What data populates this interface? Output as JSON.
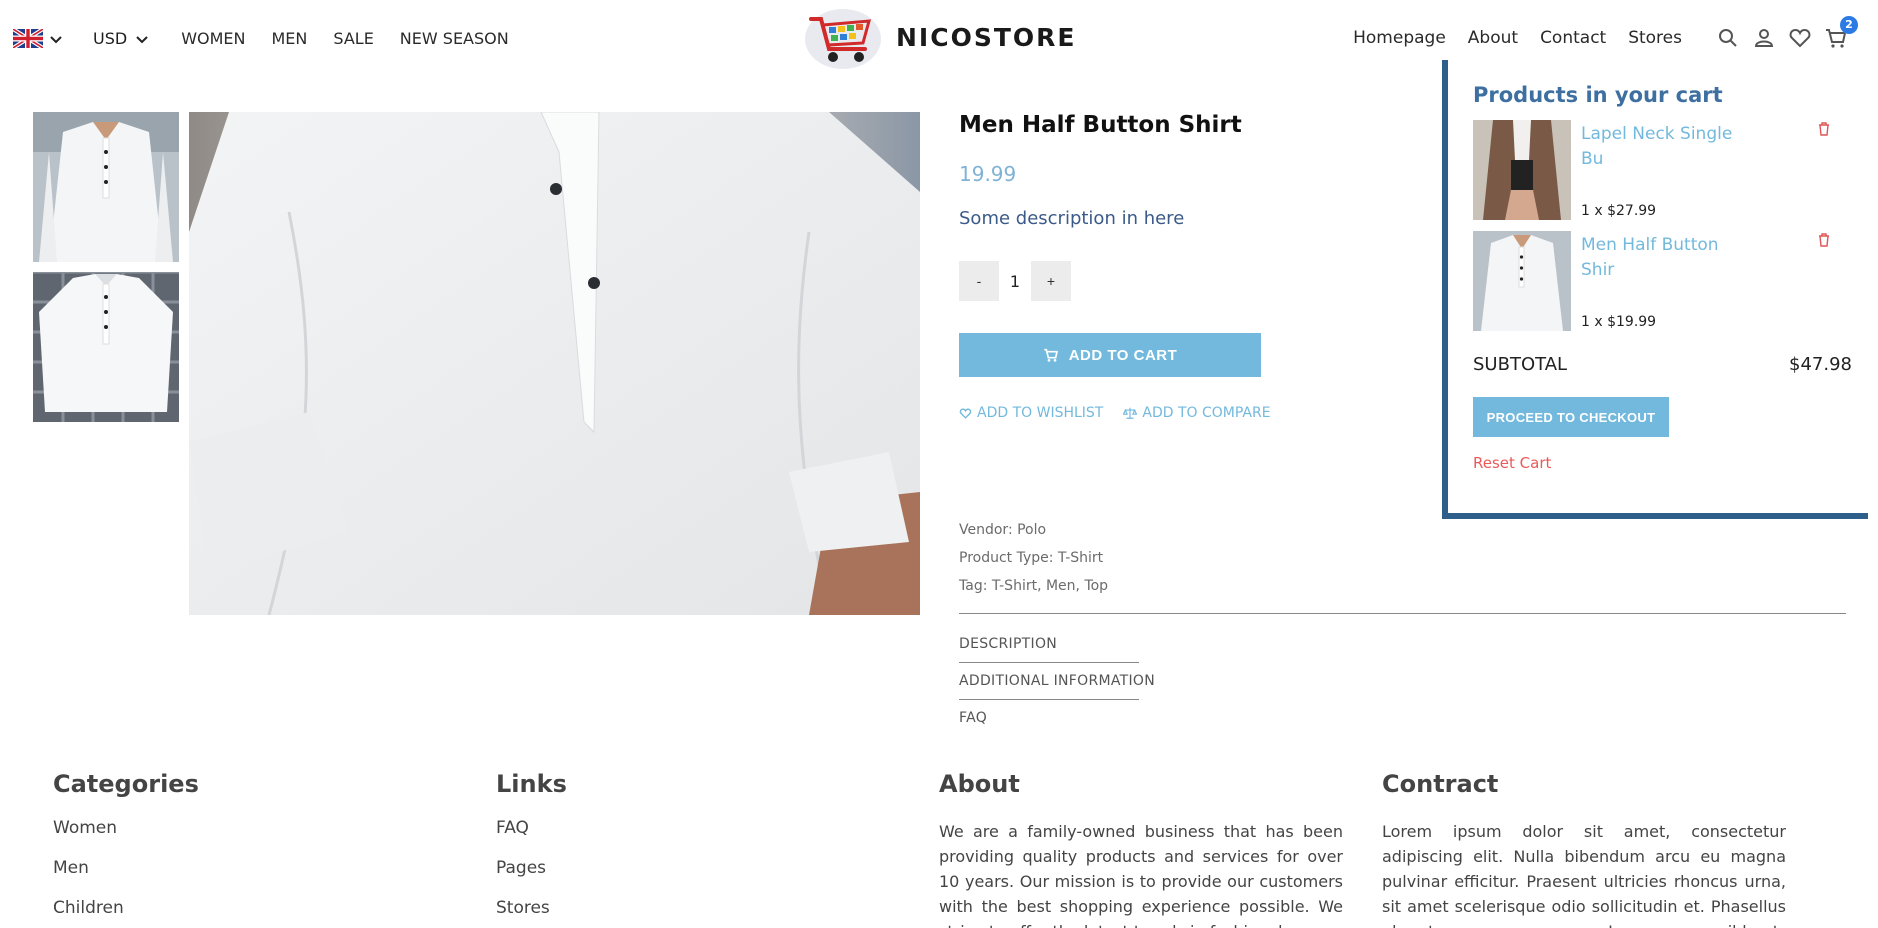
{
  "nav": {
    "currency": "USD",
    "left_links": [
      "WOMEN",
      "MEN",
      "SALE",
      "NEW SEASON"
    ],
    "logo_text": "NICOSTORE",
    "right_links": [
      "Homepage",
      "About",
      "Contact",
      "Stores"
    ],
    "cart_count": "2",
    "icons": [
      "flag-uk-icon",
      "chevron-down-icon",
      "search-icon",
      "user-icon",
      "heart-icon",
      "cart-icon"
    ]
  },
  "product": {
    "title": "Men Half Button Shirt",
    "price": "19.99",
    "description": "Some description in here",
    "qty_minus": "-",
    "qty_value": "1",
    "qty_plus": "+",
    "add_to_cart": "ADD TO CART",
    "add_to_wishlist": "ADD TO WISHLIST",
    "add_to_compare": "ADD TO COMPARE",
    "vendor": "Vendor: Polo",
    "product_type": "Product Type: T-Shirt",
    "tags": "Tag: T-Shirt, Men, Top",
    "tabs": [
      "DESCRIPTION",
      "ADDITIONAL INFORMATION",
      "FAQ"
    ]
  },
  "cart": {
    "title": "Products in your cart",
    "items": [
      {
        "name": "Lapel Neck Single Bu",
        "qty_line": "1 x $27.99"
      },
      {
        "name": "Men Half Button Shir",
        "qty_line": "1 x $19.99"
      }
    ],
    "subtotal_label": "SUBTOTAL",
    "subtotal_value": "$47.98",
    "checkout": "PROCEED TO CHECKOUT",
    "reset": "Reset Cart"
  },
  "footer": {
    "categories": {
      "title": "Categories",
      "items": [
        "Women",
        "Men",
        "Children"
      ]
    },
    "links": {
      "title": "Links",
      "items": [
        "FAQ",
        "Pages",
        "Stores"
      ]
    },
    "about": {
      "title": "About",
      "text": "We are a family-owned business that has been providing quality products and services for over 10 years. Our mission is to provide our customers with the best shopping experience possible. We strive to offer the latest trends in fashion, home"
    },
    "contract": {
      "title": "Contract",
      "text": "Lorem ipsum dolor sit amet, consectetur adipiscing elit. Nulla bibendum arcu eu magna pulvinar efficitur. Praesent ultricies rhoncus urna, sit amet scelerisque odio sollicitudin et. Phasellus pharetra accumsan magna. In semper ex nibh, ut"
    }
  },
  "colors": {
    "accent": "#72b9dd",
    "cart_title": "#3d6fa1",
    "cart_shadow": "#2e5f8a",
    "reset": "#ea5a5a",
    "badge": "#2c7be5"
  }
}
